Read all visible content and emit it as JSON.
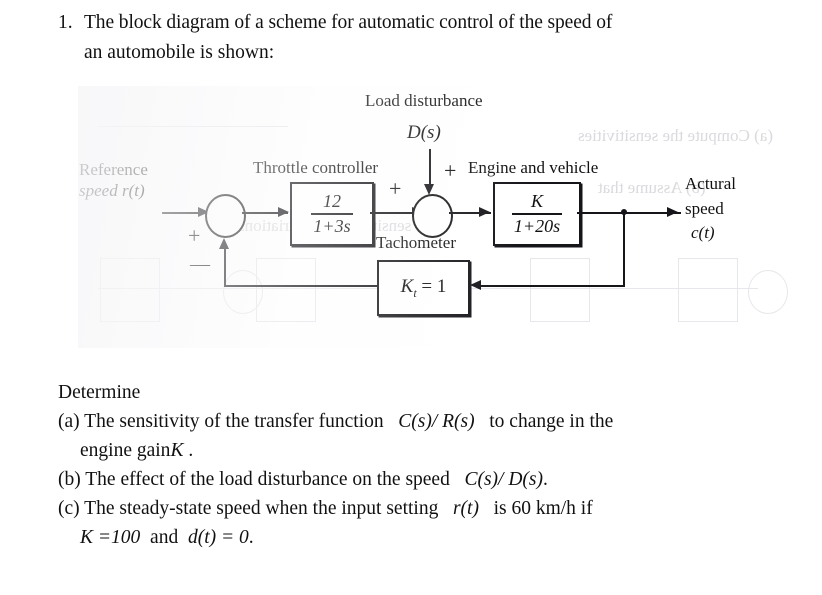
{
  "question": {
    "number": "1.",
    "line1": "The block diagram of a scheme for automatic control of the speed of",
    "line2": "an automobile is shown:"
  },
  "figure": {
    "load_disturbance_label": "Load disturbance",
    "load_disturbance_signal": "D(s)",
    "reference_label_line1": "Reference",
    "reference_label_line2": "speed r(t)",
    "throttle_label": "Throttle controller",
    "throttle_numerator": "12",
    "throttle_denominator": "1+3s",
    "engine_label": "Engine and vehicle",
    "engine_numerator": "K",
    "engine_denominator": "1+20s",
    "tachometer_label": "Tachometer",
    "tachometer_gain_symbol": "K",
    "tachometer_gain_subscript": "t",
    "tachometer_gain_value": "= 1",
    "output_label_line1": "Actural",
    "output_label_line2": "speed",
    "output_label_line3": "c(t)",
    "sign_sum1_plus": "+",
    "sign_sum1_minus": "—",
    "sign_sum2_plus_left": "+",
    "sign_sum2_plus_top": "+"
  },
  "determine": {
    "heading": "Determine",
    "a_part1": "(a) The sensitivity of the transfer function",
    "a_math": "C(s)/ R(s)",
    "a_part2": "to change in the",
    "a_line2_text": "engine gain",
    "a_line2_math": "K",
    "a_line2_period": ".",
    "b_part1": "(b) The effect of the load disturbance on the speed",
    "b_math": "C(s)/ D(s)",
    "b_period": ".",
    "c_part1": "(c) The steady-state speed when the input setting",
    "c_math": "r(t)",
    "c_part2": "is 60 km/h if",
    "c_line2_math1": "K =100",
    "c_line2_and": "and",
    "c_line2_math2": "d(t) = 0",
    "c_line2_period": "."
  },
  "ghost": {
    "g1": "(a) Compute the sensitivities",
    "g2": "(b) Assume that",
    "g3": "less sensitive to the variations"
  },
  "colors": {
    "ink": "#16161a",
    "paper": "#ffffff",
    "ghost": "#d9dade"
  }
}
